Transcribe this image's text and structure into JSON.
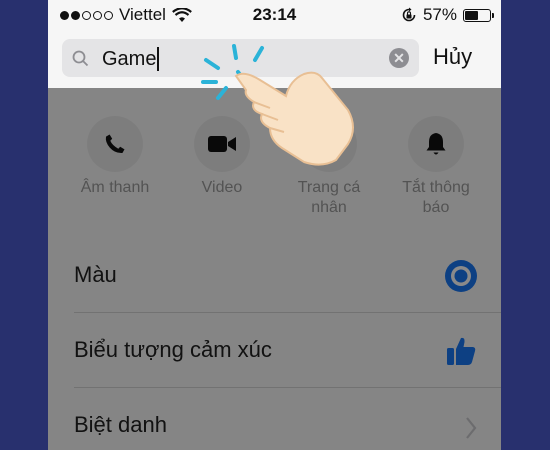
{
  "status_bar": {
    "carrier": "Viettel",
    "time": "23:14",
    "battery_percent": "57%",
    "battery_level": 0.57,
    "signal_filled": 2,
    "signal_total": 5
  },
  "search": {
    "value": "Game",
    "cancel_label": "Hủy"
  },
  "actions": [
    {
      "label_line1": "Âm thanh",
      "label_line2": "",
      "icon": "phone-icon"
    },
    {
      "label_line1": "Video",
      "label_line2": "",
      "icon": "video-camera-icon"
    },
    {
      "label_line1": "Trang cá",
      "label_line2": "nhân",
      "icon": "profile-icon"
    },
    {
      "label_line1": "Tắt thông",
      "label_line2": "báo",
      "icon": "bell-icon"
    }
  ],
  "settings": [
    {
      "label": "Màu",
      "icon": "color-dot-icon"
    },
    {
      "label": "Biểu tượng cảm xúc",
      "icon": "thumbs-up-icon"
    },
    {
      "label": "Biệt danh",
      "icon": "chevron-right-icon"
    }
  ],
  "colors": {
    "accent": "#1877f2",
    "tap_marks": "#2bb3d8",
    "background": "#28306e"
  }
}
